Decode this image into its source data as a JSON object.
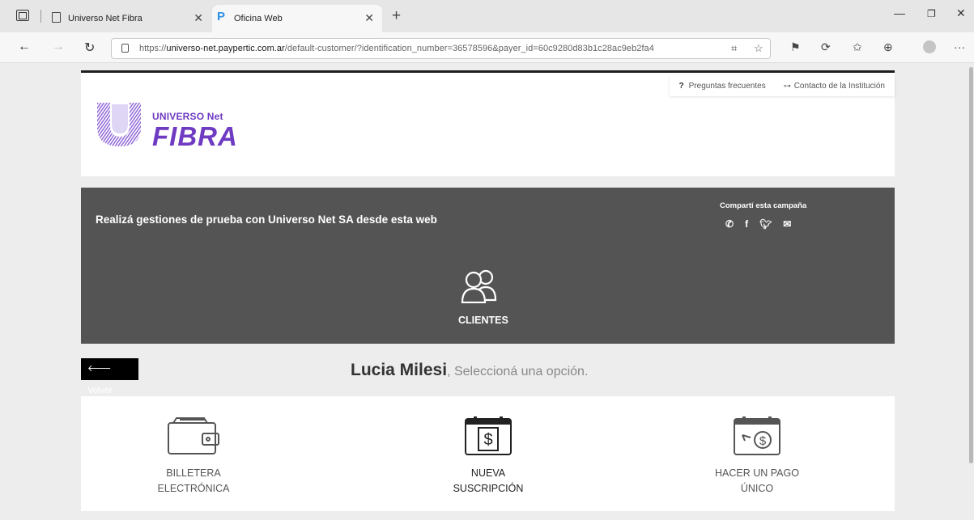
{
  "browser": {
    "tabs": [
      {
        "title": "Universo Net Fibra",
        "icon": "page-icon",
        "active": false
      },
      {
        "title": "Oficina Web",
        "icon": "paypertic-icon",
        "active": true
      }
    ],
    "url_host": "universo-net.paypertic.com.ar",
    "url_prefix": "https://",
    "url_path": "/default-customer/?identification_number=36578596&payer_id=60c9280d83b1c28ac9eb2fa4"
  },
  "header": {
    "links": [
      {
        "label": "Preguntas frecuentes",
        "icon": "question-icon"
      },
      {
        "label": "Contacto de la Institución",
        "icon": "contact-icon"
      }
    ],
    "logo_small": "UNIVERSO Net",
    "logo_big": "FIBRA"
  },
  "banner": {
    "text": "Realizá gestiones de prueba con Universo Net SA desde esta web",
    "share_title": "Compartí esta campaña",
    "share_icons": [
      "whatsapp-icon",
      "facebook-icon",
      "twitter-icon",
      "email-icon"
    ],
    "section_label": "CLIENTES"
  },
  "greeting": {
    "back_label": "Volver",
    "name": "Lucia Milesi",
    "prompt": ", Seleccioná una opción."
  },
  "options": [
    {
      "line1": "BILLETERA",
      "line2": "ELECTRÓNICA",
      "icon": "wallet-icon"
    },
    {
      "line1": "NUEVA",
      "line2": "SUSCRIPCIÓN",
      "icon": "calendar-dollar-icon"
    },
    {
      "line1": "HACER UN PAGO",
      "line2": "ÚNICO",
      "icon": "calendar-coin-icon"
    }
  ],
  "colors": {
    "brand_purple": "#6e3bc2",
    "banner_bg": "#545454",
    "page_bg": "#ededed"
  }
}
